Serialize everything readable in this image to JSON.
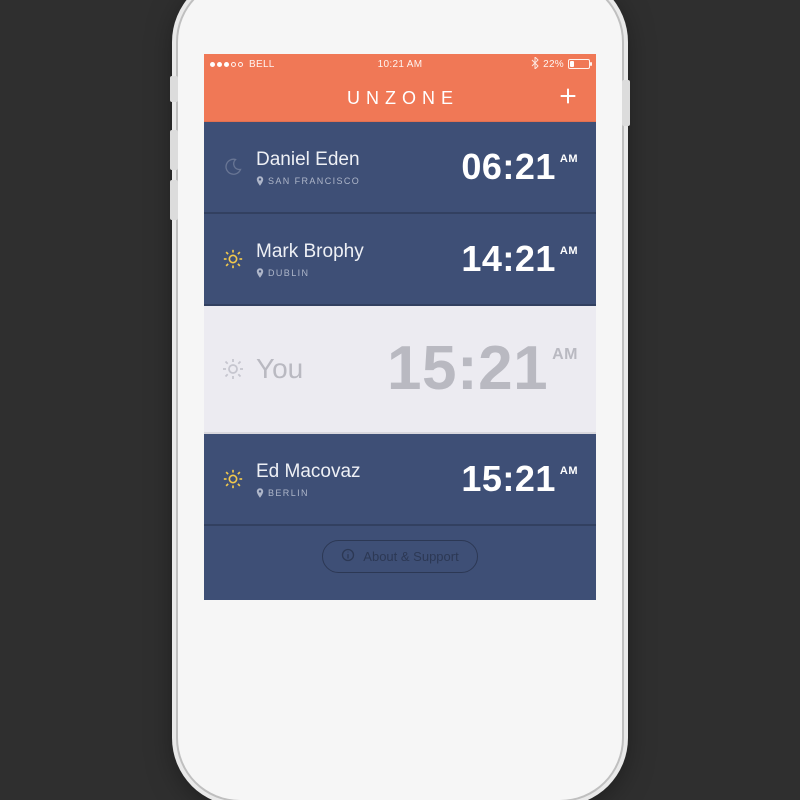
{
  "statusbar": {
    "carrier": "BELL",
    "time": "10:21 AM",
    "battery_pct_text": "22%",
    "battery_pct": 22,
    "signal_filled": 3,
    "signal_total": 5
  },
  "header": {
    "title": "UNZONE"
  },
  "rows": [
    {
      "key": "daniel",
      "name": "Daniel Eden",
      "location": "SAN FRANCISCO",
      "time": "06:21",
      "ampm": "AM",
      "icon": "moon",
      "style": "normal"
    },
    {
      "key": "mark",
      "name": "Mark Brophy",
      "location": "DUBLIN",
      "time": "14:21",
      "ampm": "AM",
      "icon": "sun",
      "style": "normal"
    },
    {
      "key": "you",
      "name": "You",
      "location": "",
      "time": "15:21",
      "ampm": "AM",
      "icon": "sun-dim",
      "style": "you"
    },
    {
      "key": "ed",
      "name": "Ed Macovaz",
      "location": "BERLIN",
      "time": "15:21",
      "ampm": "AM",
      "icon": "sun",
      "style": "normal"
    }
  ],
  "footer": {
    "about_label": "About & Support"
  },
  "colors": {
    "accent": "#f07856",
    "row_bg": "#3e4f76",
    "you_bg": "#ecebf1",
    "sun": "#f2c94c"
  }
}
